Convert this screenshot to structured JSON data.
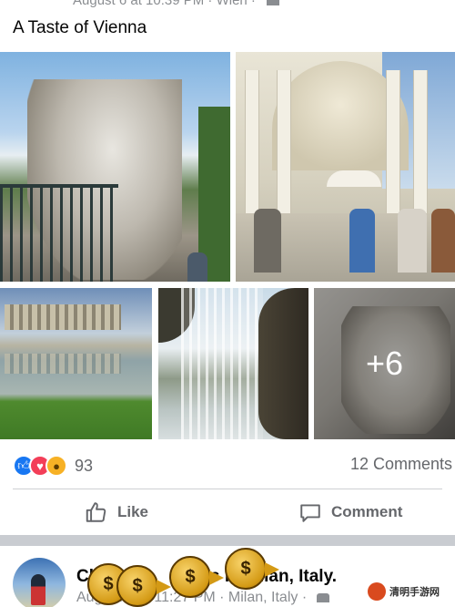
{
  "post": {
    "meta_top": "August 6 at 10:39 PM · Wien ·",
    "text": "A Taste of Vienna",
    "photos": [
      {
        "name": "schonbrunn-fountain-photo"
      },
      {
        "name": "colonnade-cafe-photo"
      },
      {
        "name": "gloriette-photo"
      },
      {
        "name": "waterfall-grotto-photo"
      },
      {
        "name": "statue-photo"
      }
    ],
    "more_photos_label": "+6",
    "reaction_icons": [
      "like-icon",
      "love-icon",
      "wow-icon"
    ],
    "reaction_count": "93",
    "comments_label": "12 Comments",
    "like_label": "Like",
    "comment_label": "Comment"
  },
  "next_post": {
    "title_visible": "Cl",
    "title_end": "s in Milan, Italy.",
    "meta": "August 5 at 11:27 PM · Milan, Italy ·"
  },
  "overlay": {
    "sticker_symbol": "$",
    "watermark_text": "清明手游网"
  },
  "colors": {
    "like_blue": "#1877f2",
    "love_red": "#f33e58",
    "wow_yellow": "#f7b125",
    "secondary_text": "#65676b"
  }
}
